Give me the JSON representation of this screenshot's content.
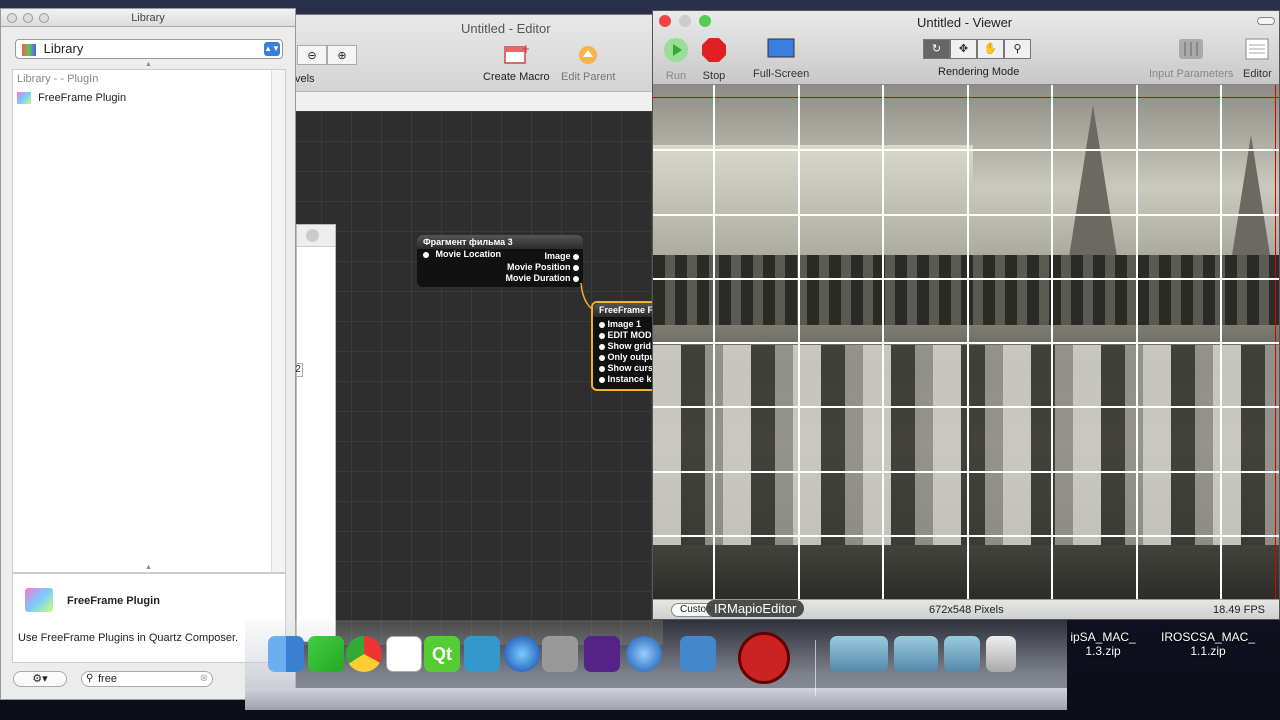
{
  "library": {
    "title": "Library",
    "selector_label": "Library",
    "path": "Library - - PlugIn",
    "items": [
      {
        "label": "FreeFrame Plugin"
      }
    ],
    "detail": {
      "name": "FreeFrame Plugin",
      "description": "Use FreeFrame Plugins in Quartz Composer."
    },
    "search_value": "free"
  },
  "editor": {
    "title": "Untitled - Editor",
    "levels_label": "vels",
    "toolbar": {
      "create_macro": "Create Macro",
      "edit_parent": "Edit Parent"
    },
    "inspector_value": "2",
    "patches": [
      {
        "title": "Фрагмент фильма 3",
        "inputs": [
          "Movie Location"
        ],
        "outputs": [
          "Image",
          "Movie Position",
          "Movie Duration"
        ]
      },
      {
        "title": "FreeFrame F",
        "inputs": [
          "Image 1",
          "EDIT MODE",
          "Show grid",
          "Only outpu",
          "Show curso",
          "Instance ke"
        ]
      }
    ]
  },
  "viewer": {
    "title": "Untitled - Viewer",
    "toolbar": {
      "run": "Run",
      "stop": "Stop",
      "fullscreen": "Full-Screen",
      "rendering_mode": "Rendering Mode",
      "input_parameters": "Input Parameters",
      "editor": "Editor"
    },
    "status": {
      "size_button": "Custom",
      "pixels": "672x548 Pixels",
      "fps": "18.49 FPS"
    }
  },
  "tooltip": "IRMapioEditor",
  "desktop_files": [
    {
      "name": "ipSA_MAC_\n1.3.zip"
    },
    {
      "name": "IROSCSA_MAC_\n1.1.zip"
    }
  ],
  "dock_icons": [
    "finder-icon",
    "chrome-icon",
    "qt-icon",
    "itunes-icon",
    "quicktime-icon",
    "irmapio-icon",
    "applications-folder-icon",
    "documents-folder-icon",
    "trash-icon"
  ],
  "colors": {
    "accent_blue": "#3a7fe0",
    "stop_red": "#e02020",
    "run_green": "#3cb043",
    "patch_outline": "#f0b030"
  }
}
